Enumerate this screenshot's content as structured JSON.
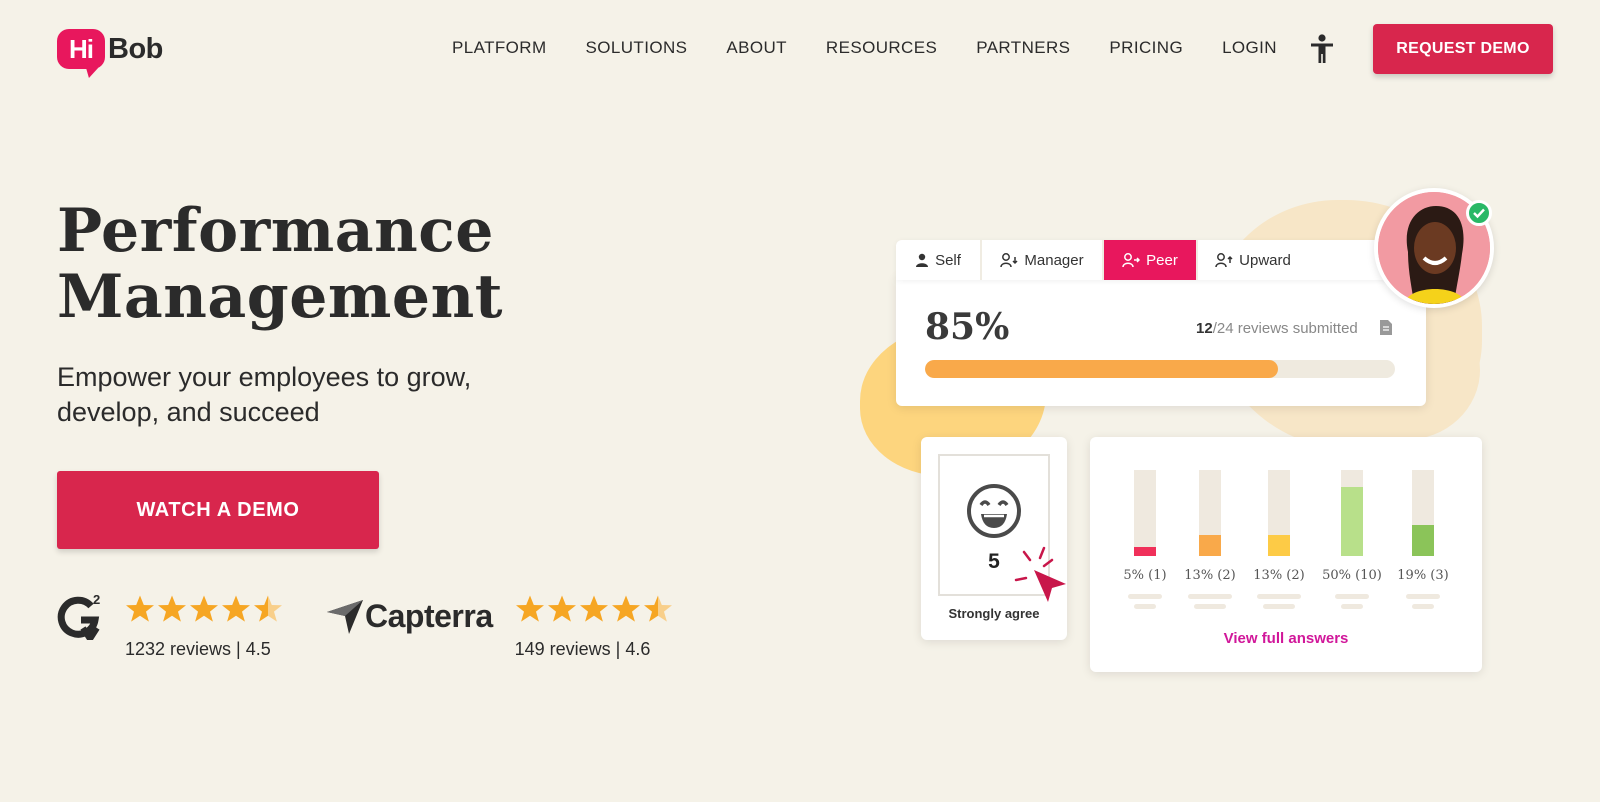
{
  "brand": {
    "logo_bubble": "Hi",
    "logo_text": "Bob",
    "primary": "#d8264d",
    "logo_pink": "#e8175d"
  },
  "nav": {
    "items": [
      "PLATFORM",
      "SOLUTIONS",
      "ABOUT",
      "RESOURCES",
      "PARTNERS",
      "PRICING",
      "LOGIN"
    ],
    "accessibility_icon": "accessibility-person-icon",
    "cta": "REQUEST DEMO"
  },
  "hero": {
    "title_line1": "Performance",
    "title_line2": "Management",
    "subtitle_line1": "Empower your employees to grow,",
    "subtitle_line2": "develop, and succeed",
    "cta": "WATCH A DEMO"
  },
  "ratings": [
    {
      "source": "G2",
      "logo_icon": "g2-logo-icon",
      "stars": 4.5,
      "text": "1232 reviews | 4.5"
    },
    {
      "source": "Capterra",
      "logo_icon": "capterra-logo-icon",
      "logo_text": "Capterra",
      "stars": 4.5,
      "text": "149 reviews | 4.6"
    }
  ],
  "review_widget": {
    "tabs": [
      {
        "label": "Self",
        "icon": "person-icon",
        "active": false
      },
      {
        "label": "Manager",
        "icon": "person-down-icon",
        "active": false
      },
      {
        "label": "Peer",
        "icon": "person-arrow-icon",
        "active": true
      },
      {
        "label": "Upward",
        "icon": "person-up-icon",
        "active": false
      }
    ],
    "percent_text": "85%",
    "submitted_count": "12",
    "submitted_rest": "/24 reviews submitted",
    "document_icon": "document-icon",
    "progress": 0.75
  },
  "score_card": {
    "face_icon": "laughing-face-icon",
    "score": "5",
    "label": "Strongly agree",
    "cursor_icon": "cursor-click-icon"
  },
  "answers_card": {
    "bars": [
      {
        "label": "5% (1)",
        "value": 0.1,
        "color": "#f0305a"
      },
      {
        "label": "13% (2)",
        "value": 0.24,
        "color": "#f9a94a"
      },
      {
        "label": "13% (2)",
        "value": 0.24,
        "color": "#fdcb46"
      },
      {
        "label": "50% (10)",
        "value": 0.8,
        "color": "#b8e08a"
      },
      {
        "label": "19% (3)",
        "value": 0.36,
        "color": "#8bc459"
      }
    ],
    "view_full": "View full answers"
  },
  "avatar": {
    "name": "avatar",
    "badge_icon": "check-badge-icon"
  }
}
